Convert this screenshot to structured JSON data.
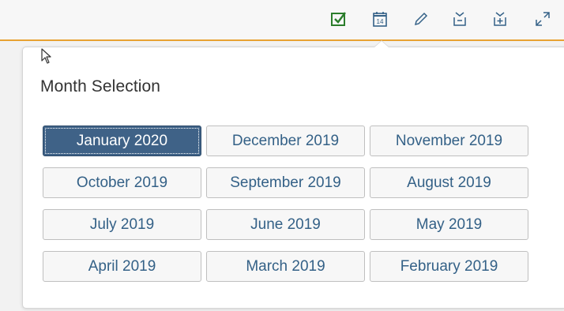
{
  "toolbar": {
    "icons": [
      {
        "name": "checkbox-check-icon",
        "color": "#2b7d2b"
      },
      {
        "name": "calendar-icon",
        "text": "14",
        "color": "#346187"
      },
      {
        "name": "pencil-icon",
        "color": "#346187"
      },
      {
        "name": "collapse-icon",
        "color": "#346187"
      },
      {
        "name": "expand-add-icon",
        "color": "#346187"
      },
      {
        "name": "fullscreen-icon",
        "color": "#346187"
      }
    ],
    "accent_color": "#e8a232"
  },
  "popover": {
    "title": "Month Selection",
    "selected_index": 0,
    "months": [
      {
        "label": "January 2020"
      },
      {
        "label": "December 2019"
      },
      {
        "label": "November 2019"
      },
      {
        "label": "October 2019"
      },
      {
        "label": "September 2019"
      },
      {
        "label": "August 2019"
      },
      {
        "label": "July 2019"
      },
      {
        "label": "June 2019"
      },
      {
        "label": "May 2019"
      },
      {
        "label": "April 2019"
      },
      {
        "label": "March 2019"
      },
      {
        "label": "February 2019"
      }
    ]
  }
}
